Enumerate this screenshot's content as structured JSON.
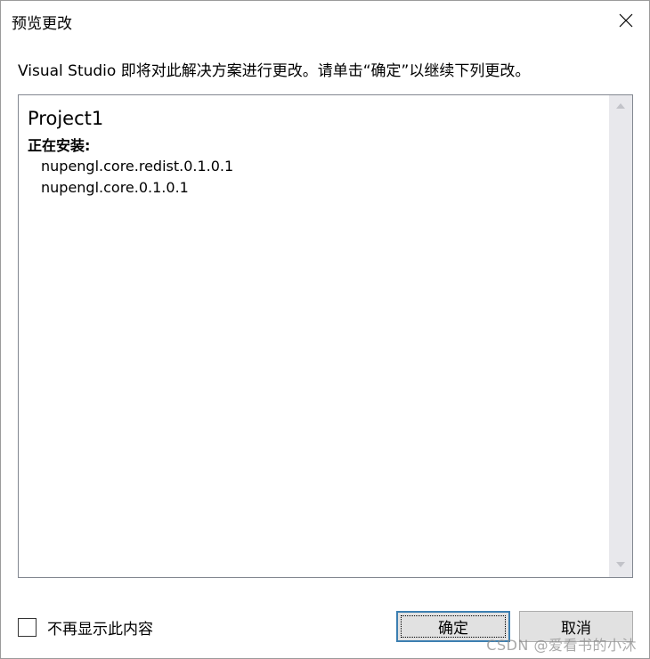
{
  "window": {
    "title": "预览更改"
  },
  "instruction": "Visual Studio 即将对此解决方案进行更改。请单击“确定”以继续下列更改。",
  "changes": {
    "project_name": "Project1",
    "section_heading": "正在安装:",
    "packages": [
      "nupengl.core.redist.0.1.0.1",
      "nupengl.core.0.1.0.1"
    ]
  },
  "footer": {
    "checkbox_label": "不再显示此内容",
    "checkbox_checked": false,
    "ok_label": "确定",
    "cancel_label": "取消"
  },
  "watermark": "CSDN @爱看书的小沐",
  "icons": {
    "close": "close-icon",
    "scroll_up": "chevron-up-icon",
    "scroll_down": "chevron-down-icon"
  },
  "colors": {
    "focus_border": "#3c7fb1",
    "button_bg": "#e1e1e1",
    "scrollbar_bg": "#e8e8ec",
    "box_border": "#828790"
  }
}
